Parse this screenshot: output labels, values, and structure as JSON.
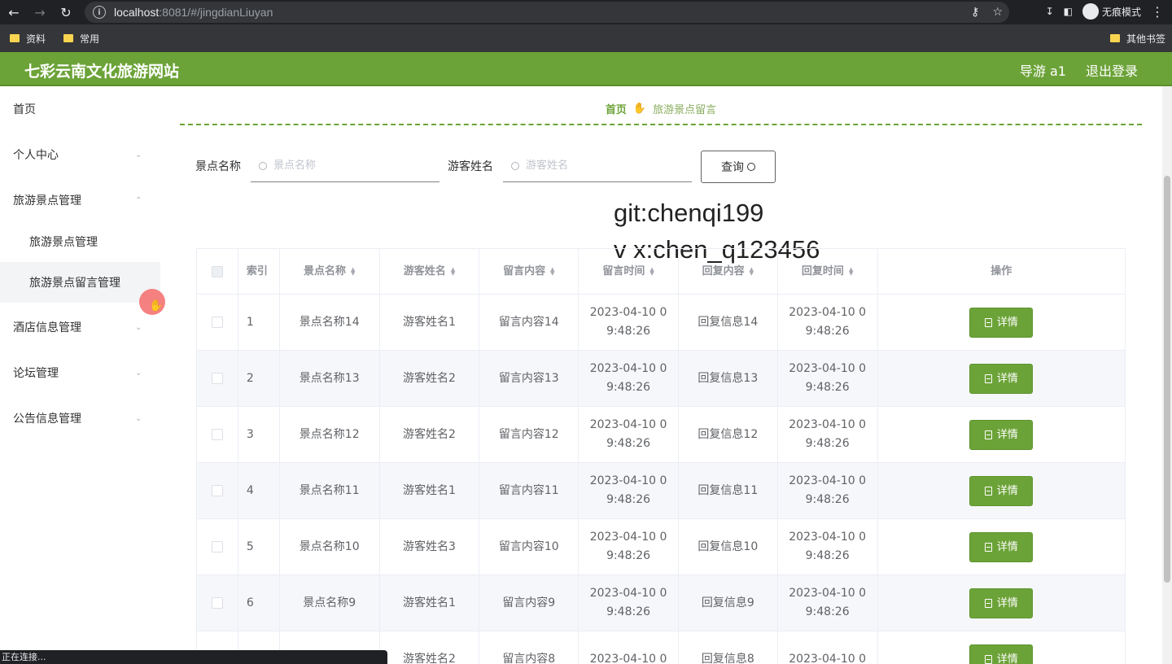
{
  "browser": {
    "url_host": "localhost",
    "url_rest": ":8081/#/jingdianLiuyan",
    "incognito_label": "无痕模式",
    "bookmarks": [
      "资料",
      "常用"
    ],
    "bookmarks_right": "其他书签",
    "status": "正在连接..."
  },
  "header": {
    "title": "七彩云南文化旅游网站",
    "user": "导游 a1",
    "logout": "退出登录"
  },
  "sidebar": {
    "items": [
      {
        "label": "首页"
      },
      {
        "label": "个人中心"
      },
      {
        "label": "旅游景点管理"
      },
      {
        "label": "旅游景点管理"
      },
      {
        "label": "旅游景点留言管理"
      },
      {
        "label": "酒店信息管理"
      },
      {
        "label": "论坛管理"
      },
      {
        "label": "公告信息管理"
      }
    ]
  },
  "breadcrumb": {
    "home": "首页",
    "current": "旅游景点留言"
  },
  "search": {
    "label1": "景点名称",
    "placeholder1": "景点名称",
    "label2": "游客姓名",
    "placeholder2": "游客姓名",
    "button": "查询"
  },
  "watermark": {
    "line1": "git:chenqi199",
    "line2": "v x:chen_q123456"
  },
  "table": {
    "headers": [
      "索引",
      "景点名称",
      "游客姓名",
      "留言内容",
      "留言时间",
      "回复内容",
      "回复时间",
      "操作"
    ],
    "detail_label": "详情",
    "rows": [
      {
        "idx": "1",
        "name": "景点名称14",
        "visitor": "游客姓名1",
        "content": "留言内容14",
        "time1": "2023-04-10 0",
        "time2": "9:48:26",
        "reply": "回复信息14",
        "rtime1": "2023-04-10 0",
        "rtime2": "9:48:26"
      },
      {
        "idx": "2",
        "name": "景点名称13",
        "visitor": "游客姓名2",
        "content": "留言内容13",
        "time1": "2023-04-10 0",
        "time2": "9:48:26",
        "reply": "回复信息13",
        "rtime1": "2023-04-10 0",
        "rtime2": "9:48:26"
      },
      {
        "idx": "3",
        "name": "景点名称12",
        "visitor": "游客姓名2",
        "content": "留言内容12",
        "time1": "2023-04-10 0",
        "time2": "9:48:26",
        "reply": "回复信息12",
        "rtime1": "2023-04-10 0",
        "rtime2": "9:48:26"
      },
      {
        "idx": "4",
        "name": "景点名称11",
        "visitor": "游客姓名1",
        "content": "留言内容11",
        "time1": "2023-04-10 0",
        "time2": "9:48:26",
        "reply": "回复信息11",
        "rtime1": "2023-04-10 0",
        "rtime2": "9:48:26"
      },
      {
        "idx": "5",
        "name": "景点名称10",
        "visitor": "游客姓名3",
        "content": "留言内容10",
        "time1": "2023-04-10 0",
        "time2": "9:48:26",
        "reply": "回复信息10",
        "rtime1": "2023-04-10 0",
        "rtime2": "9:48:26"
      },
      {
        "idx": "6",
        "name": "景点名称9",
        "visitor": "游客姓名1",
        "content": "留言内容9",
        "time1": "2023-04-10 0",
        "time2": "9:48:26",
        "reply": "回复信息9",
        "rtime1": "2023-04-10 0",
        "rtime2": "9:48:26"
      },
      {
        "idx": "",
        "name": "",
        "visitor": "游客姓名2",
        "content": "留言内容8",
        "time1": "2023-04-10 0",
        "time2": "",
        "reply": "回复信息8",
        "rtime1": "2023-04-10 0",
        "rtime2": ""
      }
    ]
  }
}
